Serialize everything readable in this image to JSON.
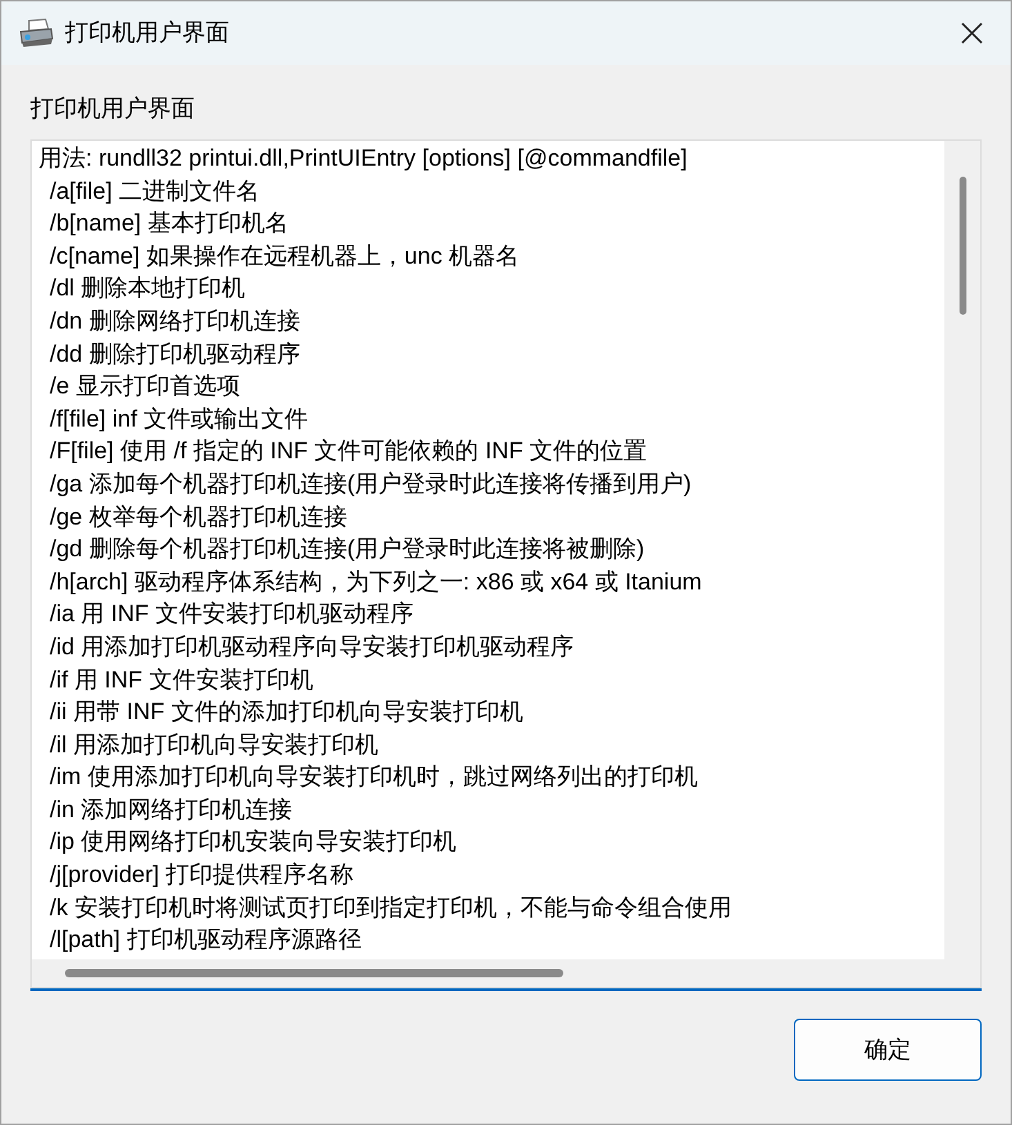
{
  "window": {
    "title": "打印机用户界面"
  },
  "label": "打印机用户界面",
  "text_lines": [
    "用法: rundll32 printui.dll,PrintUIEntry [options] [@commandfile]",
    "/a[file] 二进制文件名",
    "/b[name] 基本打印机名",
    "/c[name] 如果操作在远程机器上，unc 机器名",
    "/dl 删除本地打印机",
    "/dn 删除网络打印机连接",
    "/dd 删除打印机驱动程序",
    "/e 显示打印首选项",
    "/f[file] inf 文件或输出文件",
    "/F[file] 使用 /f 指定的 INF 文件可能依赖的 INF 文件的位置",
    "/ga 添加每个机器打印机连接(用户登录时此连接将传播到用户)",
    "/ge 枚举每个机器打印机连接",
    "/gd 删除每个机器打印机连接(用户登录时此连接将被删除)",
    "/h[arch] 驱动程序体系结构，为下列之一: x86 或 x64 或 Itanium",
    "/ia 用 INF 文件安装打印机驱动程序",
    "/id 用添加打印机驱动程序向导安装打印机驱动程序",
    "/if 用 INF 文件安装打印机",
    "/ii 用带 INF 文件的添加打印机向导安装打印机",
    "/il 用添加打印机向导安装打印机",
    "/im 使用添加打印机向导安装打印机时，跳过网络列出的打印机",
    "/in 添加网络打印机连接",
    "/ip 使用网络打印机安装向导安装打印机",
    "/j[provider] 打印提供程序名称",
    "/k 安装打印机时将测试页打印到指定打印机，不能与命令组合使用",
    "/l[path] 打印机驱动程序源路径"
  ],
  "buttons": [
    "确定"
  ]
}
